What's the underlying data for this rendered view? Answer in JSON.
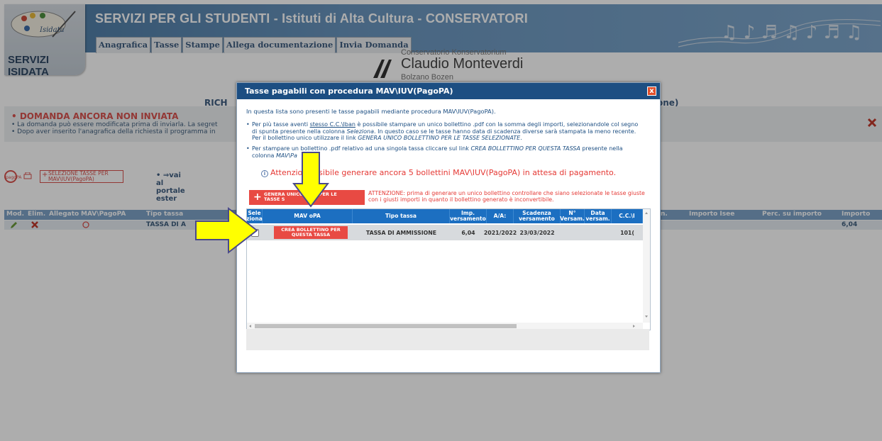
{
  "header": {
    "app_title": "SERVIZI PER GLI STUDENTI - Istituti di Alta Cultura - CONSERVATORI",
    "logo_text": "SERVIZI ISIDATA",
    "menu": [
      "Anagrafica",
      "Tasse",
      "Stampe",
      "Allega documentazione",
      "Invia Domanda"
    ],
    "conservatorio_small": "Conservatorio Konservatorium",
    "conservatorio_name": "Claudio Monteverdi",
    "conservatorio_city": "Bolzano Bozen"
  },
  "background": {
    "heading_left": "RICH",
    "heading_right": "one)",
    "notice_title": "• DOMANDA ANCORA NON INVIATA",
    "notice_line1": "• La domanda può essere modificata prima di inviarla. La segret",
    "notice_line2": "• Dopo aver inserito l'anagrafica della richiesta il programma in",
    "pagopa_icon_label": "pagoPA",
    "selezione_btn": "SELEZIONE TASSE PER MAV\\IUV(PagoPA)",
    "portal_link": "• ⇒vai al portale ester",
    "table_headers": [
      "Mod.",
      "Elim.",
      "Allegato",
      "MAV\\PagoPA",
      "Tipo tassa",
      "n.",
      "Importo Isee",
      "Perc. su importo",
      "Importo"
    ],
    "table_row": {
      "tipo": "TASSA DI A",
      "importo": "6,04"
    }
  },
  "modal": {
    "title": "Tasse pagabili con procedura MAV\\IUV(PagoPA)",
    "close_label": "x",
    "intro": "In questa lista sono presenti le tasse pagabili mediante procedura MAV\\IUV(PagoPA).",
    "bullet1_a": "Per più tasse aventi ",
    "bullet1_u": "stesso C.C.\\Iban",
    "bullet1_b": " è possibile stampare un unico bollettino .pdf con la somma degli importi, selezionandole col segno",
    "bullet1_c": "di spunta presente nella colonna ",
    "bullet1_ci": "Seleziona",
    "bullet1_d": ". In questo caso se le tasse hanno data di scadenza diverse sarà stampata la meno recente.",
    "bullet1_e": "Per il bollettino unico utilizzare il link ",
    "bullet1_ei": "GENERA UNICO BOLLETTINO PER LE TASSE SELEZIONATE",
    "bullet1_f": ".",
    "bullet2_a": "Per stampare un bollettino .pdf relativo ad una singola tassa cliccare sul link ",
    "bullet2_ai": "CREA BOLLETTINO PER QUESTA TASSA",
    "bullet2_b": " presente nella",
    "bullet2_c": "colonna ",
    "bullet2_ci": "MAV\\Pa",
    "attention": "Attenzion      ossibile generare ancora 5 bollettini MAV\\IUV(PagoPA) in attesa di pagamento.",
    "genera_btn": "GENERA UNICO          TINO PER LE TASSE S",
    "warning": "ATTENZIONE: prima di generare un unico bollettino controllare che siano selezionate le tasse giuste con i giusti importi in quanto il bollettino generato è inconvertibile.",
    "grid": {
      "headers": [
        "Sele ziona",
        "MAV      oPA",
        "Tipo tassa",
        "Imp. versamento",
        "A/A:",
        "Scadenza versamento",
        "N° Versam.",
        "Data versam.",
        "C.C.\\I"
      ],
      "row": {
        "crea_btn": "CREA BOLLETTINO PER QUESTA TASSA",
        "tipo": "TASSA DI AMMISSIONE",
        "importo": "6,04",
        "anno": "2021/2022",
        "scadenza": "23/03/2022",
        "n_versam": "",
        "data_versam": "",
        "cc": "101("
      }
    }
  },
  "colors": {
    "titlebar": "#1c4e82",
    "header_blue": "#1c6fc1",
    "accent_red": "#e84a43",
    "arrow_yellow": "#ffff00"
  }
}
